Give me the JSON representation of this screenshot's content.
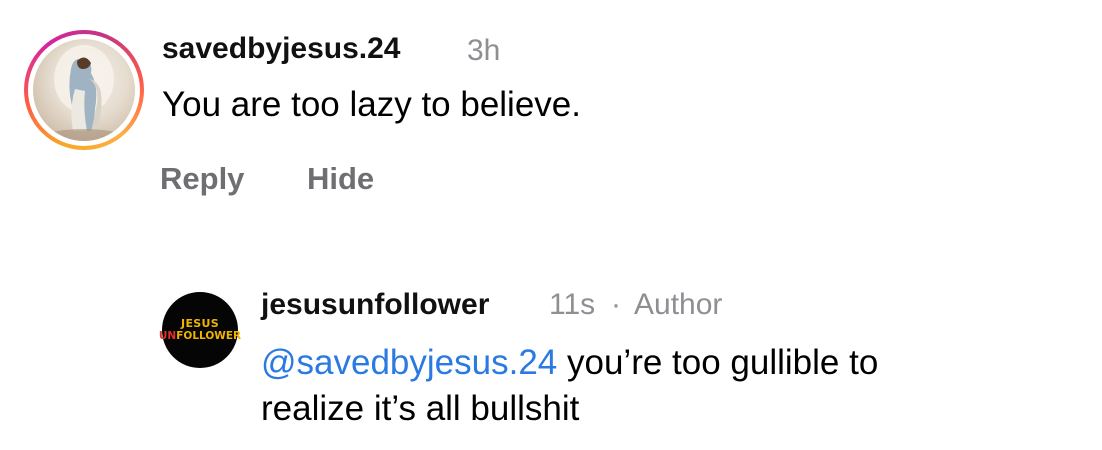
{
  "comments": [
    {
      "username": "savedbyjesus.24",
      "time": "3h",
      "text": "You are too lazy to believe.",
      "actions": {
        "reply": "Reply",
        "hide": "Hide"
      }
    },
    {
      "username": "jesusunfollower",
      "time": "11s",
      "separator": "·",
      "role": "Author",
      "mention": "@savedbyjesus.24",
      "text_line1": " you’re too gullible to",
      "text_line2": "realize it’s all bullshit",
      "avatar_logo": {
        "top": "JESUS",
        "bottom_un": "UN",
        "bottom_rest": "FOLLOWER"
      }
    }
  ],
  "colors": {
    "mention": "#2a7ae2",
    "muted": "#8e8e93",
    "action": "#6e6e73",
    "story_ring": [
      "#f9a825",
      "#fd5949",
      "#d6249f"
    ],
    "logo_yellow": "#f0b400",
    "logo_red": "#e0302a"
  }
}
